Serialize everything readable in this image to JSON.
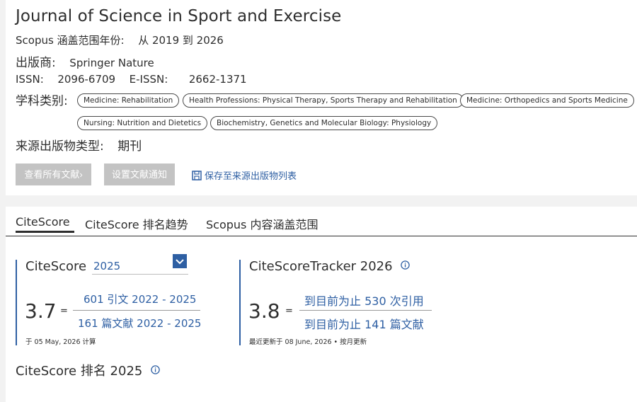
{
  "journal": {
    "title": "Journal of Science in Sport and Exercise",
    "coverage_label": "Scopus 涵盖范围年份:",
    "coverage_value": "从 2019 到 2026",
    "publisher_label": "出版商:",
    "publisher_value": "Springer Nature",
    "issn_label": "ISSN:",
    "issn_value": "2096-6709",
    "eissn_label": "E-ISSN:",
    "eissn_value": "2662-1371",
    "subject_label": "学科类别:",
    "subjects": [
      "Medicine: Rehabilitation",
      "Health Professions: Physical Therapy, Sports Therapy and Rehabilitation",
      "Medicine: Orthopedics and Sports Medicine",
      "Nursing: Nutrition and Dietetics",
      "Biochemistry, Genetics and Molecular Biology: Physiology"
    ],
    "source_type_label": "来源出版物类型:",
    "source_type_value": "期刊"
  },
  "actions": {
    "view_all_docs": "查看所有文献",
    "set_alert": "设置文献通知",
    "save_to_list": "保存至来源出版物列表"
  },
  "tabs": [
    {
      "label": "CiteScore",
      "active": true
    },
    {
      "label": "CiteScore 排名趋势",
      "active": false
    },
    {
      "label": "Scopus 内容涵盖范围",
      "active": false
    }
  ],
  "citescore": {
    "title": "CiteScore",
    "year": "2025",
    "value": "3.7",
    "equals": "=",
    "numerator": "601 引文 2022 - 2025",
    "denominator": "161 篇文献 2022 - 2025",
    "calc_note": "于 05 May, 2026 计算"
  },
  "tracker": {
    "title": "CiteScoreTracker 2026",
    "value": "3.8",
    "equals": "=",
    "numerator": "到目前为止 530 次引用",
    "denominator": "到目前为止 141 篇文献",
    "update_note": "最近更新于 08 June, 2026 • 按月更新"
  },
  "ranking": {
    "title": "CiteScore 排名 2025"
  },
  "colors": {
    "accent": "#2e5fa3",
    "button_disabled": "#c3c3c3",
    "page_bg": "#f2f2f2",
    "text": "#2e2e2e"
  }
}
